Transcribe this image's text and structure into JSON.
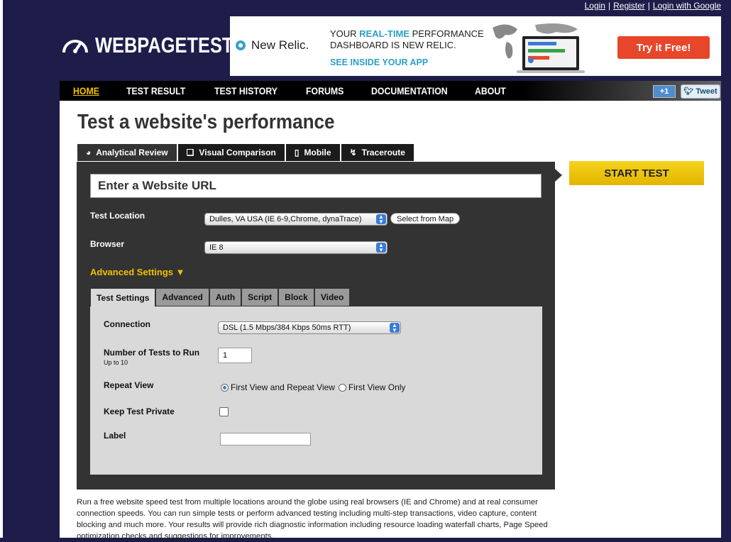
{
  "top_links": {
    "login": "Login",
    "register": "Register",
    "login_google": "Login with Google",
    "separator": "|"
  },
  "logo": {
    "text": "WEBPAGETEST",
    "icon": "speedometer-icon"
  },
  "ad": {
    "brand": "New Relic.",
    "headline_pre": "YOUR ",
    "headline_hl": "REAL-TIME",
    "headline_post": " PERFORMANCE",
    "headline_line2": "DASHBOARD IS NEW RELIC.",
    "cta": "SEE INSIDE YOUR APP",
    "button": "Try it Free!"
  },
  "nav": {
    "items": [
      "HOME",
      "TEST RESULT",
      "TEST HISTORY",
      "FORUMS",
      "DOCUMENTATION",
      "ABOUT"
    ],
    "plus_one": "+1",
    "tweet": "Tweet"
  },
  "page": {
    "title": "Test a website's performance"
  },
  "tabs": [
    {
      "label": "Analytical Review",
      "icon": "gauge-icon"
    },
    {
      "label": "Visual Comparison",
      "icon": "document-icon"
    },
    {
      "label": "Mobile",
      "icon": "phone-icon"
    },
    {
      "label": "Traceroute",
      "icon": "route-icon"
    }
  ],
  "form": {
    "url_placeholder": "Enter a Website URL",
    "test_location_label": "Test Location",
    "test_location_value": "Dulles, VA USA (IE 6-9,Chrome, dynaTrace)",
    "select_from_map": "Select from Map",
    "browser_label": "Browser",
    "browser_value": "IE 8",
    "advanced_settings": "Advanced Settings ▼"
  },
  "subtabs": [
    "Test Settings",
    "Advanced",
    "Auth",
    "Script",
    "Block",
    "Video"
  ],
  "settings": {
    "connection_label": "Connection",
    "connection_value": "DSL (1.5 Mbps/384 Kbps 50ms RTT)",
    "num_tests_label": "Number of Tests to Run",
    "num_tests_sub": "Up to 10",
    "num_tests_value": "1",
    "repeat_view_label": "Repeat View",
    "repeat_option_1": "First View and Repeat View",
    "repeat_option_2": "First View Only",
    "private_label": "Keep Test Private",
    "label_label": "Label"
  },
  "start_test": "START TEST",
  "description": "Run a free website speed test from multiple locations around the globe using real browsers (IE and Chrome) and at real consumer connection speeds. You can run simple tests or perform advanced testing including multi-step transactions, video capture, content blocking and much more. Your results will provide rich diagnostic information including resource loading waterfall charts, Page Speed optimization checks and suggestions for improvements."
}
